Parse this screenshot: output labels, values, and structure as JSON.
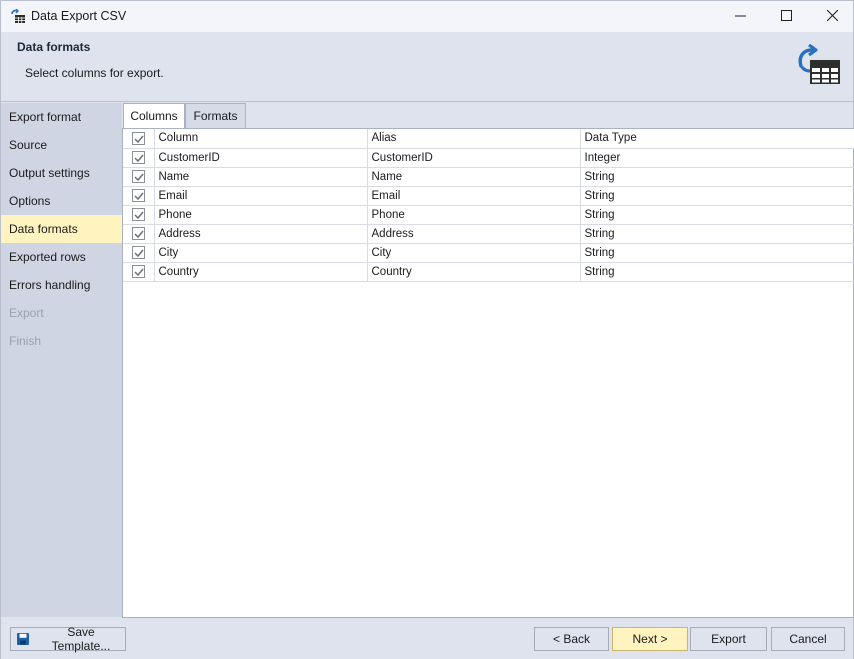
{
  "window": {
    "title": "Data Export CSV",
    "icons": {
      "app": "table-export-icon",
      "minimize": "minimize-icon",
      "maximize": "maximize-icon",
      "close": "close-icon"
    }
  },
  "header": {
    "title": "Data formats",
    "subtitle": "Select columns for export.",
    "icon": "table-export-icon"
  },
  "sidebar": {
    "items": [
      {
        "label": "Export format",
        "state": "normal"
      },
      {
        "label": "Source",
        "state": "normal"
      },
      {
        "label": "Output settings",
        "state": "normal"
      },
      {
        "label": "Options",
        "state": "normal"
      },
      {
        "label": "Data formats",
        "state": "active"
      },
      {
        "label": "Exported rows",
        "state": "normal"
      },
      {
        "label": "Errors handling",
        "state": "normal"
      },
      {
        "label": "Export",
        "state": "disabled"
      },
      {
        "label": "Finish",
        "state": "disabled"
      }
    ]
  },
  "tabs": [
    {
      "label": "Columns",
      "selected": true
    },
    {
      "label": "Formats",
      "selected": false
    }
  ],
  "grid": {
    "header_checked": true,
    "columns": [
      "Column",
      "Alias",
      "Data Type"
    ],
    "rows": [
      {
        "checked": true,
        "column": "CustomerID",
        "alias": "CustomerID",
        "type": "Integer"
      },
      {
        "checked": true,
        "column": "Name",
        "alias": "Name",
        "type": "String"
      },
      {
        "checked": true,
        "column": "Email",
        "alias": "Email",
        "type": "String"
      },
      {
        "checked": true,
        "column": "Phone",
        "alias": "Phone",
        "type": "String"
      },
      {
        "checked": true,
        "column": "Address",
        "alias": "Address",
        "type": "String"
      },
      {
        "checked": true,
        "column": "City",
        "alias": "City",
        "type": "String"
      },
      {
        "checked": true,
        "column": "Country",
        "alias": "Country",
        "type": "String"
      }
    ]
  },
  "footer": {
    "save_template": "Save Template...",
    "back": "< Back",
    "next": "Next >",
    "export": "Export",
    "cancel": "Cancel"
  },
  "colors": {
    "accent_active": "#fff3c0",
    "sidebar_bg": "#cfd5e3",
    "window_bg": "#dfe3ee",
    "icon_blue": "#2a6fc0"
  }
}
